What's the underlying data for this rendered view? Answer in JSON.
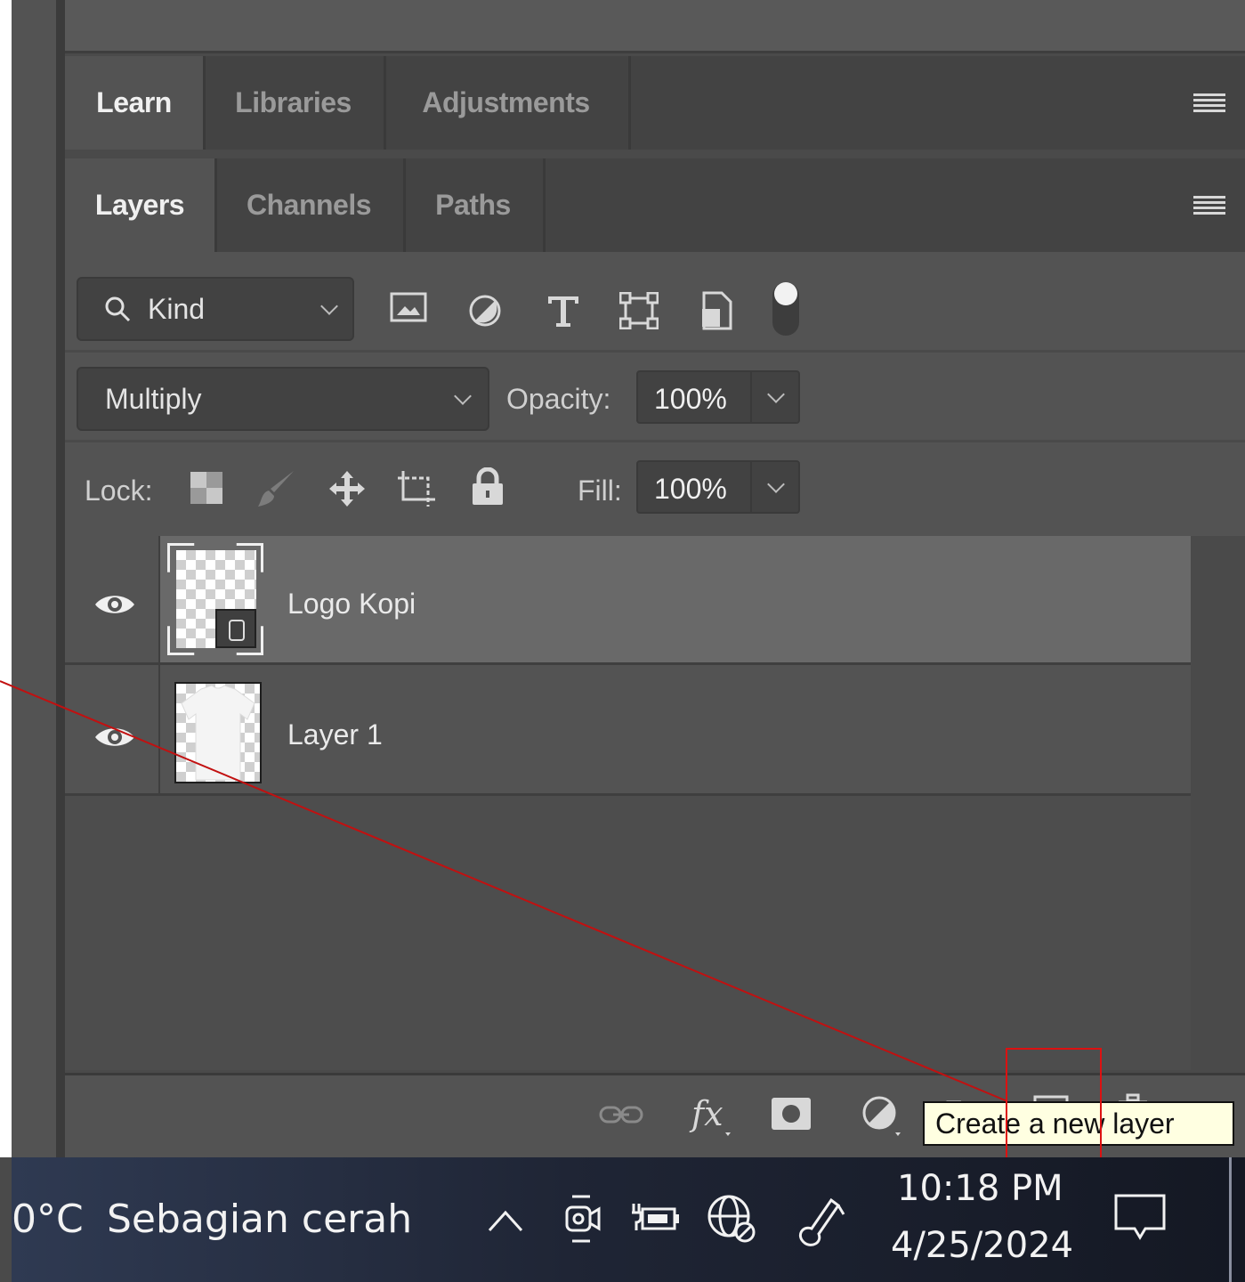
{
  "panel_tabs_top": [
    "Learn",
    "Libraries",
    "Adjustments"
  ],
  "panel_tabs_layers": [
    "Layers",
    "Channels",
    "Paths"
  ],
  "filter": {
    "kind_label": "Kind",
    "icons": [
      "image-filter-icon",
      "adjustment-filter-icon",
      "type-filter-icon",
      "shape-filter-icon",
      "smart-object-filter-icon"
    ]
  },
  "blend": {
    "mode": "Multiply",
    "opacity_label": "Opacity:",
    "opacity_value": "100%"
  },
  "lock": {
    "label": "Lock:",
    "fill_label": "Fill:",
    "fill_value": "100%"
  },
  "layers": [
    {
      "name": "Logo Kopi",
      "selected": true,
      "visible": true
    },
    {
      "name": "Layer 1",
      "selected": false,
      "visible": true
    }
  ],
  "bottom_icons": [
    "link-layers-icon",
    "fx-icon",
    "add-mask-icon",
    "adjustment-layer-icon",
    "group-icon",
    "new-layer-icon",
    "delete-layer-icon"
  ],
  "tooltip": "Create a new layer",
  "taskbar": {
    "weather_temp": "0°C",
    "weather_desc": "Sebagian cerah",
    "time": "10:18 PM",
    "date": "4/25/2024"
  },
  "colors": {
    "panel": "#535353",
    "selected_layer": "#696969",
    "tooltip_bg": "#ffffe1",
    "annotation": "#d11111"
  }
}
